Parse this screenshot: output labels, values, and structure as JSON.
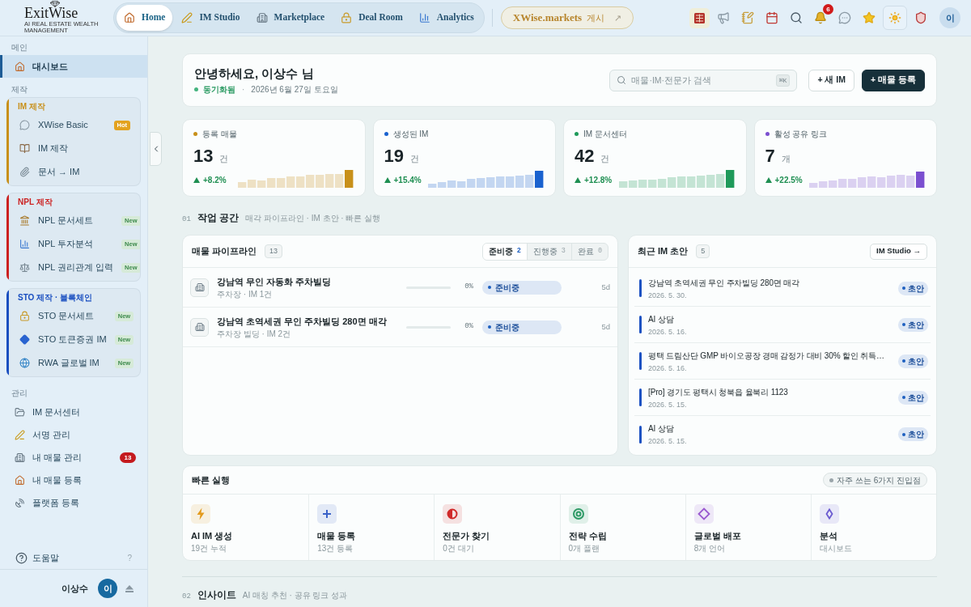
{
  "header": {
    "logo": {
      "name": "ExitWise",
      "tagline": "AI REAL ESTATE WEALTH MANAGEMENT"
    },
    "nav": [
      {
        "label": "Home",
        "selected": true
      },
      {
        "label": "IM Studio",
        "selected": false
      },
      {
        "label": "Marketplace",
        "selected": false
      },
      {
        "label": "Deal Room",
        "selected": false
      },
      {
        "label": "Analytics",
        "selected": false
      }
    ],
    "market_button": {
      "label": "XWise.markets",
      "suffix": "게시",
      "arrow": "↗"
    },
    "notifications": "6",
    "avatar": "이"
  },
  "sidebar": {
    "sections": [
      {
        "label": "메인",
        "items": [
          {
            "label": "대시보드",
            "selected": true
          }
        ]
      },
      {
        "label": "제작",
        "groups": [
          {
            "title": "IM 제작",
            "color": "#c8901a",
            "items": [
              {
                "label": "XWise Basic",
                "selected": false,
                "badge": {
                  "text": "Hot",
                  "kind": "hot"
                }
              },
              {
                "label": "IM 제작",
                "selected": false
              },
              {
                "label": "문서 → IM",
                "selected": false
              }
            ]
          },
          {
            "title": "NPL 제작",
            "color": "#cc2222",
            "items": [
              {
                "label": "NPL 문서세트",
                "selected": false,
                "badge": {
                  "text": "New",
                  "kind": "new"
                }
              },
              {
                "label": "NPL 투자분석",
                "selected": false,
                "badge": {
                  "text": "New",
                  "kind": "new"
                }
              },
              {
                "label": "NPL 권리관계 입력",
                "selected": false,
                "badge": {
                  "text": "New",
                  "kind": "new"
                }
              }
            ]
          },
          {
            "title": "STO 제작 · 블록체인",
            "color": "#1a4fc0",
            "items": [
              {
                "label": "STO 문서세트",
                "selected": false,
                "badge": {
                  "text": "New",
                  "kind": "new"
                }
              },
              {
                "label": "STO 토큰증권 IM",
                "selected": false,
                "badge": {
                  "text": "New",
                  "kind": "new"
                }
              },
              {
                "label": "RWA 글로벌 IM",
                "selected": false,
                "badge": {
                  "text": "New",
                  "kind": "new"
                }
              }
            ]
          }
        ]
      },
      {
        "label": "관리",
        "items": [
          {
            "label": "IM 문서센터",
            "selected": false
          },
          {
            "label": "서명 관리",
            "selected": false
          },
          {
            "label": "내 매물 관리",
            "selected": false,
            "count": "13"
          },
          {
            "label": "내 매물 등록",
            "selected": false
          },
          {
            "label": "플랫폼 등록",
            "selected": false
          }
        ]
      }
    ],
    "help": {
      "label": "도움말",
      "hint": "?"
    },
    "user": {
      "name": "이상수",
      "avatar": "이"
    }
  },
  "greeting": {
    "title": "안녕하세요, 이상수 님",
    "status": "동기화됨",
    "separator": "·",
    "date": "2026년 6월 27일 토요일",
    "search": {
      "placeholder": "매물·IM·전문가 검색",
      "shortcut": "⌘K"
    },
    "buttons": [
      {
        "label": "+ 새 IM",
        "kind": "secondary"
      },
      {
        "label": "+ 매물 등록",
        "kind": "primary"
      }
    ]
  },
  "stats": [
    {
      "label": "등록 매물",
      "color": "#c8901a",
      "value": "13",
      "unit": "건",
      "change": "+8.2%"
    },
    {
      "label": "생성된 IM",
      "color": "#1a62cf",
      "value": "19",
      "unit": "건",
      "change": "+15.4%"
    },
    {
      "label": "IM 문서센터",
      "color": "#1f9a5a",
      "value": "42",
      "unit": "건",
      "change": "+12.8%"
    },
    {
      "label": "활성 공유 링크",
      "color": "#7b4fd0",
      "value": "7",
      "unit": "개",
      "change": "+22.5%"
    }
  ],
  "section_1": {
    "number": "01",
    "title": "작업 공간",
    "subtitle": "매각 파이프라인 · IM 초안 · 빠른 실행"
  },
  "pipeline": {
    "title": "매물 파이프라인",
    "count": "13",
    "tabs": [
      {
        "label": "준비중",
        "count": "2",
        "selected": true
      },
      {
        "label": "진행중",
        "count": "3",
        "selected": false
      },
      {
        "label": "완료",
        "count": "0",
        "selected": false
      }
    ],
    "rows": [
      {
        "title": "강남역 무인 자동화 주차빌딩",
        "subtitle": "주차장 · IM 1건",
        "level": 0,
        "percent": "0%",
        "status": "준비중",
        "age": "5d"
      },
      {
        "title": "강남역 초역세권 무인 주차빌딩 280면 매각",
        "subtitle": "주차장 빌딩 · IM 2건",
        "level": 0,
        "percent": "0%",
        "status": "준비중",
        "age": "5d"
      }
    ]
  },
  "recent_im": {
    "title": "최근 IM 초안",
    "count": "5",
    "link": "IM Studio →",
    "items": [
      {
        "title": "강남역 초역세권 무인 주차빌딩 280면 매각",
        "date": "2026. 5. 30.",
        "badge": "초안"
      },
      {
        "title": "AI 상담",
        "date": "2026. 5. 16.",
        "badge": "초안"
      },
      {
        "title": "평택 드림산단 GMP 바이오공장 경매 감정가 대비 30% 할인 취득…",
        "date": "2026. 5. 16.",
        "badge": "초안"
      },
      {
        "title": "[Pro] 경기도 평택시 청북읍 율북리 1123",
        "date": "2026. 5. 15.",
        "badge": "초안"
      },
      {
        "title": "AI 상담",
        "date": "2026. 5. 15.",
        "badge": "초안"
      }
    ]
  },
  "quick_actions": {
    "title": "빠른 실행",
    "hint": "자주 쓰는 6가지 진입점",
    "items": [
      {
        "title": "AI IM 생성",
        "subtitle": "19건 누적",
        "color": "#e39a1c"
      },
      {
        "title": "매물 등록",
        "subtitle": "13건 등록",
        "color": "#3a62c8"
      },
      {
        "title": "전문가 찾기",
        "subtitle": "0건 대기",
        "color": "#d02a2a"
      },
      {
        "title": "전략 수립",
        "subtitle": "0개 플랜",
        "color": "#2e9a66"
      },
      {
        "title": "글로벌 배포",
        "subtitle": "8개 언어",
        "color": "#9a5ad0"
      },
      {
        "title": "분석",
        "subtitle": "대시보드",
        "color": "#6a5ad0"
      }
    ]
  },
  "section_2": {
    "number": "02",
    "title": "인사이트",
    "subtitle": "AI 매칭 추천 · 공유 링크 성과"
  }
}
